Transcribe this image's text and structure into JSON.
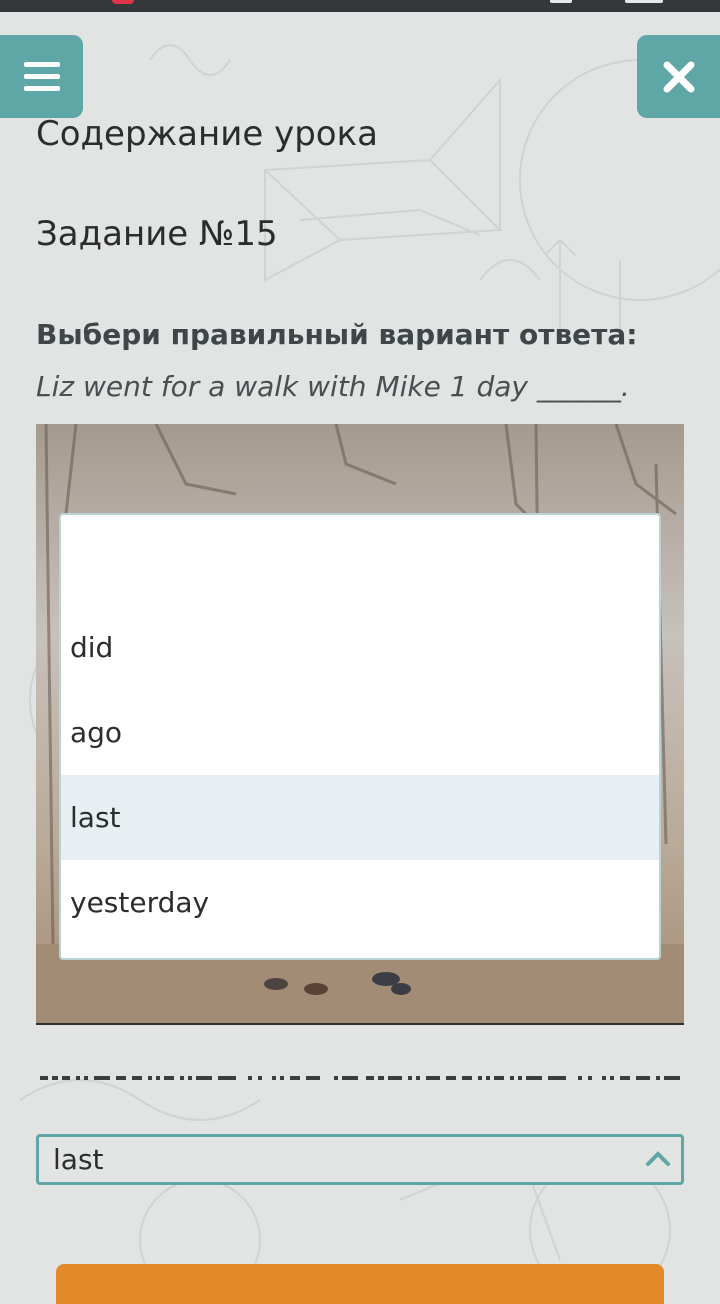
{
  "header": {
    "menu_icon": "hamburger-icon",
    "close_icon": "close-x-icon",
    "accent_color": "#5fa7a6"
  },
  "lesson": {
    "title": "Содержание урока",
    "task_title": "Задание №15",
    "instruction": "Выбери правильный вариант ответа:",
    "question": "Liz went for a walk with Mike 1 day ______."
  },
  "dropdown": {
    "options": [
      {
        "label": ""
      },
      {
        "label": "did"
      },
      {
        "label": "ago"
      },
      {
        "label": "last"
      },
      {
        "label": "yesterday"
      }
    ],
    "highlighted": "last"
  },
  "select": {
    "value": "last",
    "chevron_icon": "chevron-up-icon"
  },
  "submit": {
    "color": "#e2892a"
  }
}
